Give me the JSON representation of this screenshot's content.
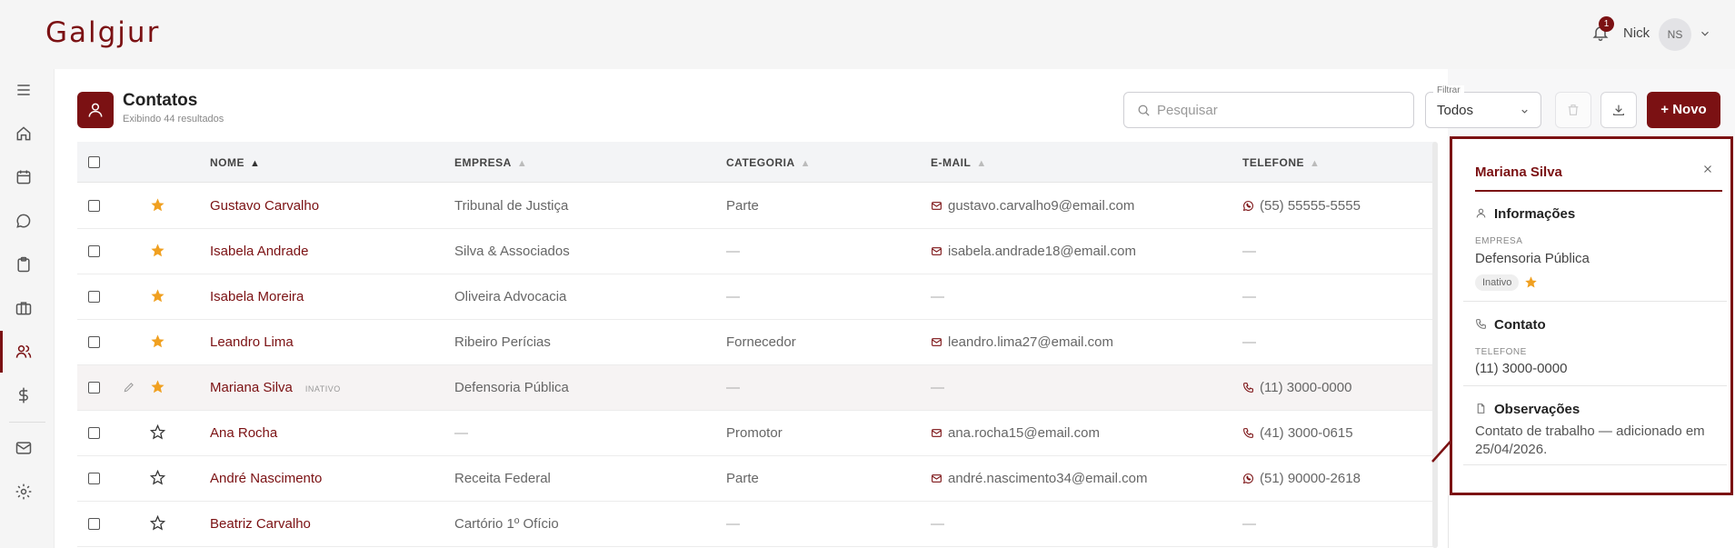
{
  "app": {
    "logo": "Galgjur",
    "notifications_count": "1",
    "user_name": "Nick",
    "user_initials": "NS"
  },
  "sidebar": {
    "items": [
      "menu",
      "home",
      "calendar",
      "chat",
      "clipboard",
      "briefcase",
      "users",
      "dollar",
      "mail",
      "settings"
    ],
    "active": "users"
  },
  "page": {
    "title": "Contatos",
    "subtitle": "Exibindo 44 resultados"
  },
  "toolbar": {
    "search_placeholder": "Pesquisar",
    "filter_label": "Filtrar",
    "filter_value": "Todos",
    "new_label": "+ Novo"
  },
  "table": {
    "columns": [
      "NOME",
      "EMPRESA",
      "CATEGORIA",
      "E-MAIL",
      "TELEFONE"
    ],
    "sort_column": "NOME",
    "rows": [
      {
        "name": "Gustavo Carvalho",
        "favorite": true,
        "company": "Tribunal de Justiça",
        "category": "Parte",
        "email": "gustavo.carvalho9@email.com",
        "phone": "(55) 55555-5555",
        "phone_type": "whatsapp",
        "status": ""
      },
      {
        "name": "Isabela Andrade",
        "favorite": true,
        "company": "Silva & Associados",
        "category": "—",
        "email": "isabela.andrade18@email.com",
        "phone": "—",
        "phone_type": "",
        "status": ""
      },
      {
        "name": "Isabela Moreira",
        "favorite": true,
        "company": "Oliveira Advocacia",
        "category": "—",
        "email": "—",
        "phone": "—",
        "phone_type": "",
        "status": ""
      },
      {
        "name": "Leandro Lima",
        "favorite": true,
        "company": "Ribeiro Perícias",
        "category": "Fornecedor",
        "email": "leandro.lima27@email.com",
        "phone": "—",
        "phone_type": "",
        "status": ""
      },
      {
        "name": "Mariana Silva",
        "favorite": true,
        "company": "Defensoria Pública",
        "category": "—",
        "email": "—",
        "phone": "(11) 3000-0000",
        "phone_type": "phone",
        "status": "INATIVO"
      },
      {
        "name": "Ana Rocha",
        "favorite": false,
        "company": "—",
        "category": "Promotor",
        "email": "ana.rocha15@email.com",
        "phone": "(41) 3000-0615",
        "phone_type": "phone",
        "status": ""
      },
      {
        "name": "André Nascimento",
        "favorite": false,
        "company": "Receita Federal",
        "category": "Parte",
        "email": "andré.nascimento34@email.com",
        "phone": "(51) 90000-2618",
        "phone_type": "whatsapp",
        "status": ""
      },
      {
        "name": "Beatriz Carvalho",
        "favorite": false,
        "company": "Cartório 1º Ofício",
        "category": "—",
        "email": "—",
        "phone": "—",
        "phone_type": "",
        "status": ""
      }
    ]
  },
  "detail_panel": {
    "title": "Mariana Silva",
    "info_heading": "Informações",
    "company_label": "EMPRESA",
    "company_value": "Defensoria Pública",
    "status_badge": "Inativo",
    "contact_heading": "Contato",
    "phone_label": "TELEFONE",
    "phone_value": "(11) 3000-0000",
    "notes_heading": "Observações",
    "notes_text": "Contato de trabalho — adicionado em 25/04/2026."
  },
  "colors": {
    "brand": "#7b1113",
    "star": "#f0a020"
  }
}
